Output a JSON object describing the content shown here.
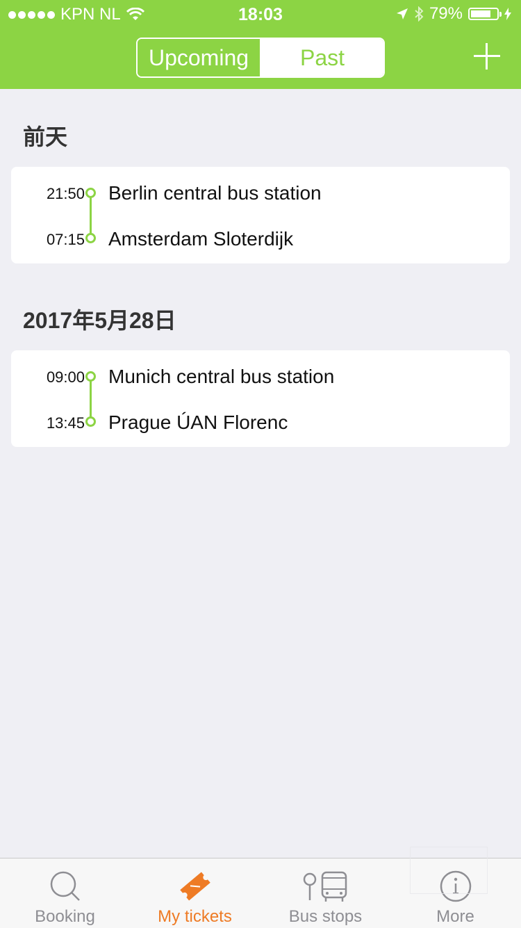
{
  "status_bar": {
    "carrier": "KPN NL",
    "time": "18:03",
    "battery_percent": "79%",
    "battery_level": 0.79
  },
  "nav": {
    "tabs": [
      {
        "label": "Upcoming",
        "selected": false
      },
      {
        "label": "Past",
        "selected": true
      }
    ],
    "add_icon": "plus-icon"
  },
  "trips": [
    {
      "date": "前天",
      "departure_time": "21:50",
      "departure_station": "Berlin central bus station",
      "arrival_time": "07:15",
      "arrival_station": "Amsterdam Sloterdijk"
    },
    {
      "date": "2017年5月28日",
      "departure_time": "09:00",
      "departure_station": "Munich central bus station",
      "arrival_time": "13:45",
      "arrival_station": "Prague ÚAN Florenc"
    }
  ],
  "tab_bar": {
    "items": [
      {
        "label": "Booking",
        "icon": "search-icon",
        "active": false
      },
      {
        "label": "My tickets",
        "icon": "ticket-icon",
        "active": true
      },
      {
        "label": "Bus stops",
        "icon": "bus-stop-icon",
        "active": false
      },
      {
        "label": "More",
        "icon": "info-icon",
        "active": false
      }
    ]
  },
  "colors": {
    "brand_green": "#8cd444",
    "active_orange": "#ee7b25",
    "background": "#efeff4"
  }
}
